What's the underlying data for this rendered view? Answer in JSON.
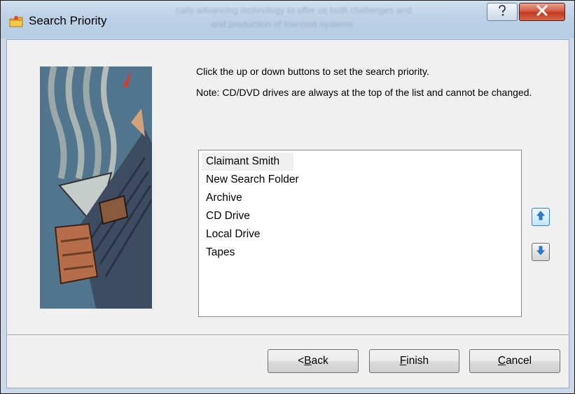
{
  "window": {
    "title": "Search Priority",
    "icon": "folder-app-icon",
    "help_icon": "help-question-icon",
    "close_icon": "close-x-icon"
  },
  "dialog": {
    "instruction": "Click the up or down buttons to set the search priority.",
    "note": "Note: CD/DVD drives are always at the top of the list and cannot be changed."
  },
  "priority_list": {
    "items": [
      {
        "label": "Claimant Smith",
        "selected": true
      },
      {
        "label": "New Search Folder",
        "selected": false
      },
      {
        "label": "Archive",
        "selected": false
      },
      {
        "label": "CD Drive",
        "selected": false
      },
      {
        "label": "Local Drive",
        "selected": false
      },
      {
        "label": "Tapes",
        "selected": false
      }
    ]
  },
  "move_buttons": {
    "up_icon": "arrow-up-icon",
    "down_icon": "arrow-down-icon"
  },
  "footer": {
    "back": {
      "prefix": "< ",
      "mnemonic": "B",
      "rest": "ack"
    },
    "finish": {
      "mnemonic": "F",
      "rest": "inish"
    },
    "cancel": {
      "mnemonic": "C",
      "rest": "ancel"
    }
  },
  "colors": {
    "titlebar": "#bcd1e6",
    "close_button": "#c3391f",
    "accent_arrow": "#2b7bd6"
  }
}
